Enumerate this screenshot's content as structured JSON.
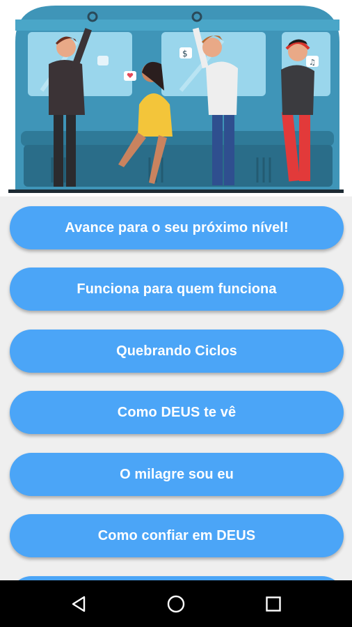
{
  "header": {
    "illustration": "people-in-subway-illustration",
    "colors": {
      "train": "#3a8fb0",
      "window": "#8fd0e8",
      "seat": "#2b6f8c"
    }
  },
  "menu": {
    "items": [
      {
        "label": "Avance para o seu próximo nível!"
      },
      {
        "label": "Funciona para quem funciona"
      },
      {
        "label": "Quebrando Ciclos"
      },
      {
        "label": "Como DEUS te vê"
      },
      {
        "label": "O milagre sou eu"
      },
      {
        "label": "Como confiar em DEUS"
      },
      {
        "label": ""
      }
    ],
    "button_color": "#4ba5f7"
  },
  "navbar": {
    "back_icon": "triangle-back-icon",
    "home_icon": "circle-home-icon",
    "recents_icon": "square-recents-icon"
  }
}
